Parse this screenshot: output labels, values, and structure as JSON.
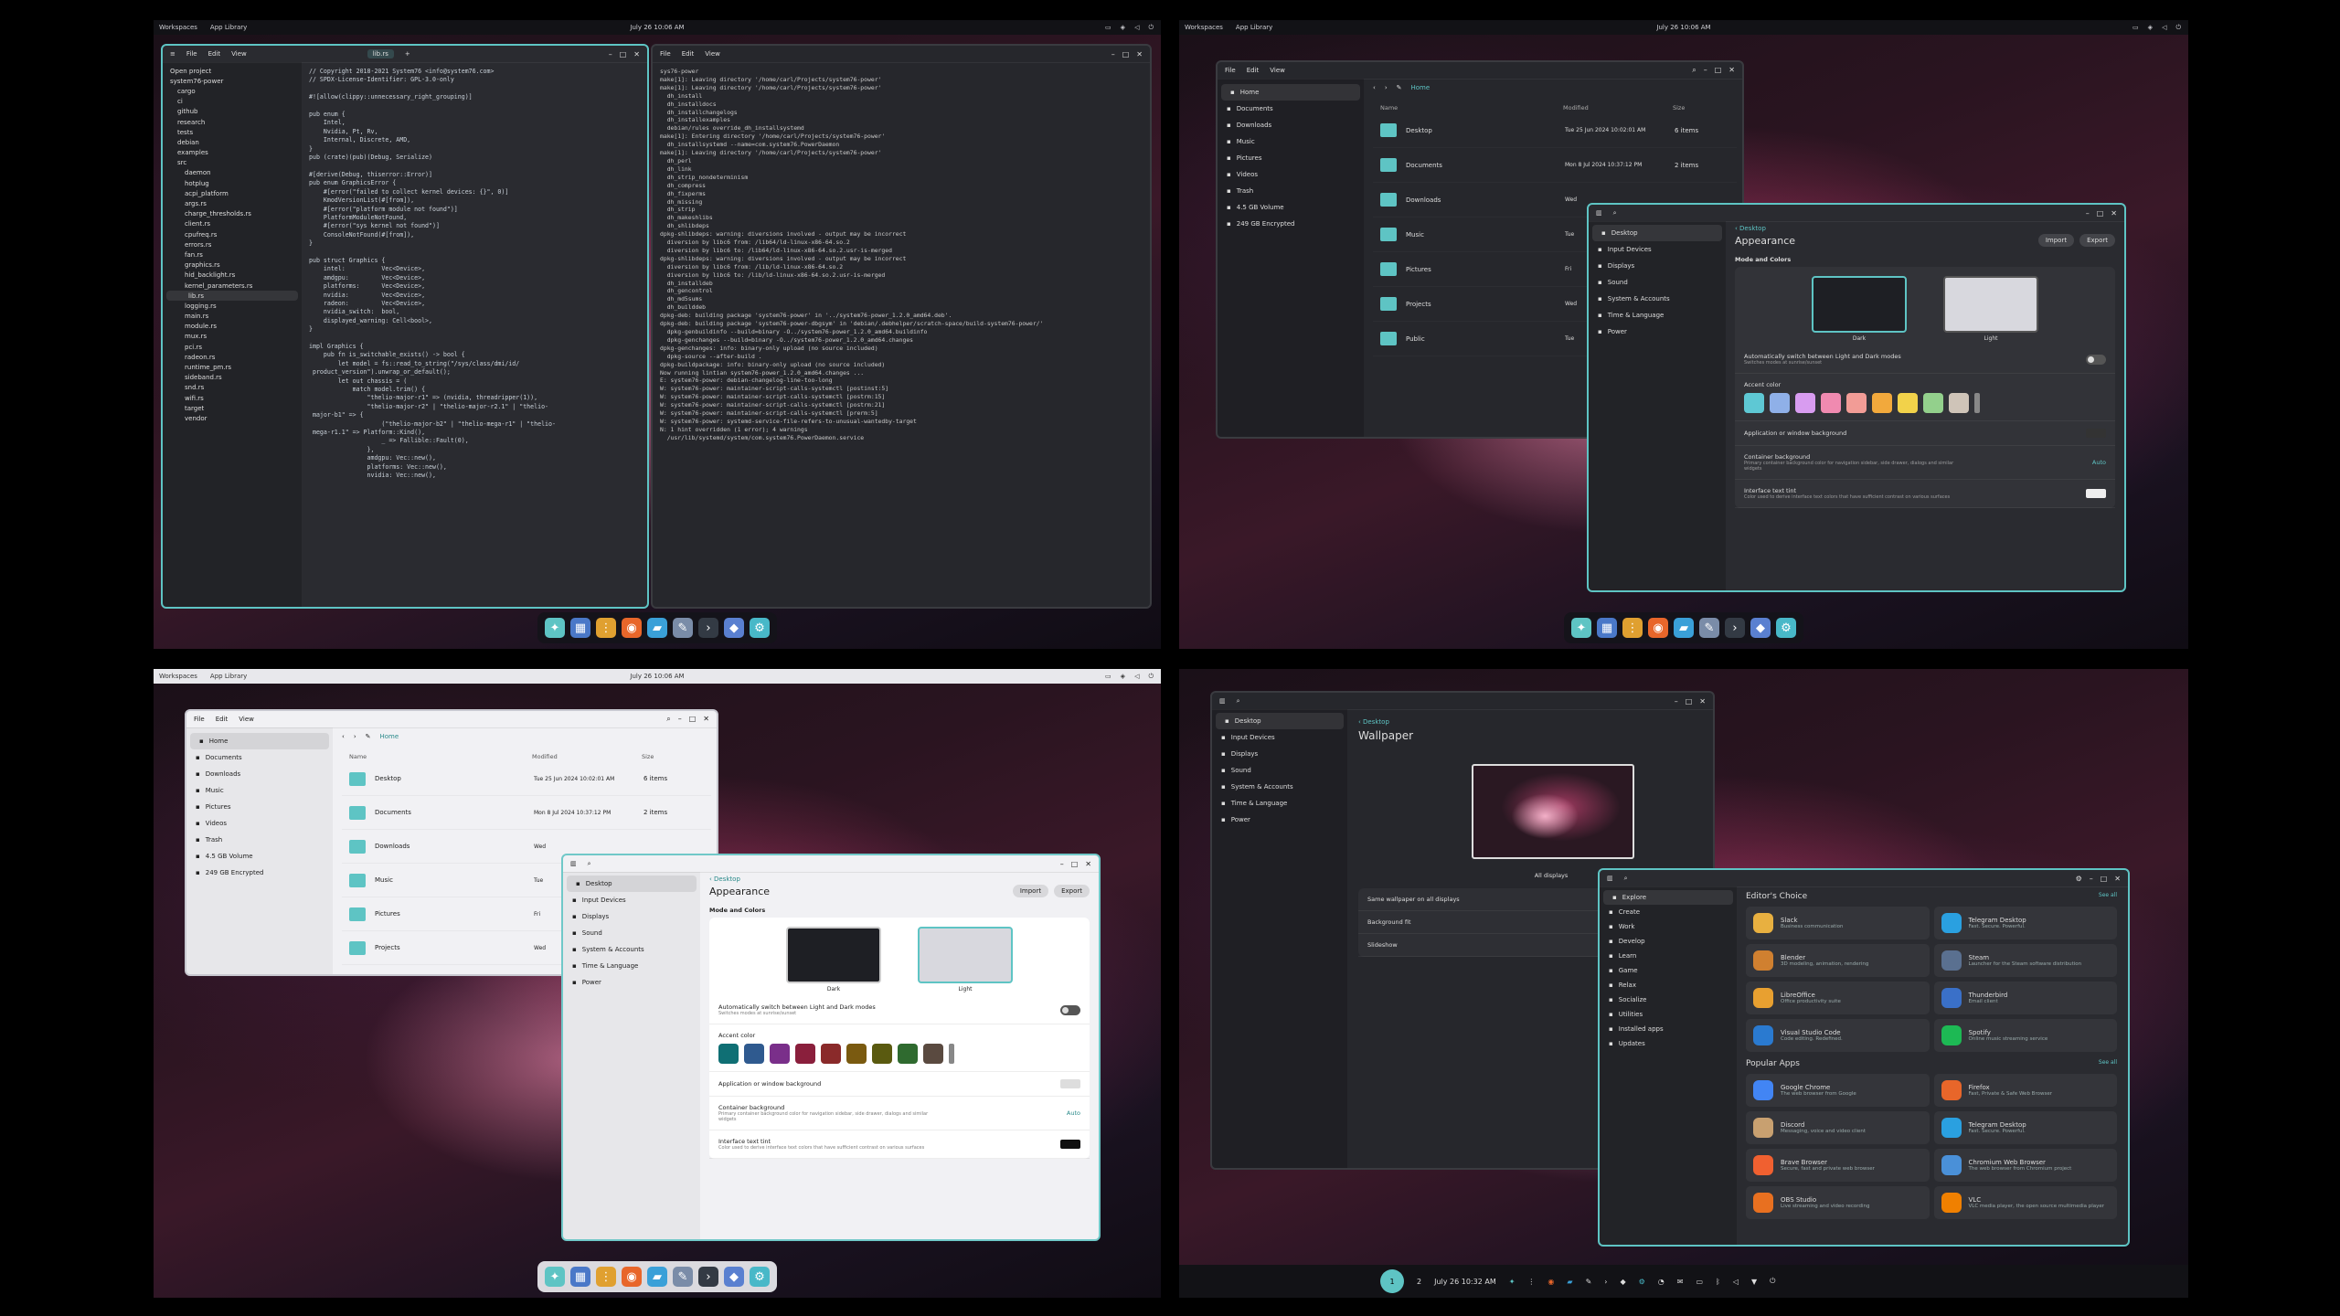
{
  "topbar": {
    "workspaces": "Workspaces",
    "apps": "App Library",
    "clock": "July 26 10:06 AM",
    "clock2": "July 26 10:06 AM",
    "clock3": "July 26 10:06 AM"
  },
  "editor": {
    "menu": [
      "File",
      "Edit",
      "View"
    ],
    "tab": "lib.rs",
    "tree": [
      "Open project",
      "system76-power",
      "cargo",
      "ci",
      "github",
      "research",
      "tests",
      "debian",
      "examples",
      "src",
      "daemon",
      "hotplug",
      "acpi_platform",
      "args.rs",
      "charge_thresholds.rs",
      "client.rs",
      "cpufreq.rs",
      "errors.rs",
      "fan.rs",
      "graphics.rs",
      "hid_backlight.rs",
      "kernel_parameters.rs",
      "lib.rs",
      "logging.rs",
      "main.rs",
      "module.rs",
      "mux.rs",
      "pci.rs",
      "radeon.rs",
      "runtime_pm.rs",
      "sideband.rs",
      "snd.rs",
      "wifi.rs",
      "target",
      "vendor"
    ],
    "code": "// Copyright 2018-2021 System76 <info@system76.com>\n// SPDX-License-Identifier: GPL-3.0-only\n\n#![allow(clippy::unnecessary_right_grouping)]\n\npub enum {\n    Intel,\n    Nvidia, Pt, Rv,\n    Internal, Discrete, AMD,\n}\npub (crate)(pub)(Debug, Serialize)\n\n#[derive(Debug, thiserror::Error)]\npub enum GraphicsError {\n    #[error(\"failed to collect kernel devices: {}\", 0)]\n    KmodVersionList(#[from]),\n    #[error(\"platform module not found\")]\n    PlatformModuleNotFound,\n    #[error(\"sys kernel not found\")]\n    ConsoleNotFound(#[from]),\n}\n\npub struct Graphics {\n    intel:          Vec<Device>,\n    amdgpu:         Vec<Device>,\n    platforms:      Vec<Device>,\n    nvidia:         Vec<Device>,\n    radeon:         Vec<Device>,\n    nvidia_switch:  bool,\n    displayed_warning: Cell<bool>,\n}\n\nimpl Graphics {\n    pub fn is_switchable_exists() -> bool {\n        let model = fs::read_to_string(\"/sys/class/dmi/id/\n product_version\").unwrap_or_default();\n        let out chassis = (\n            match model.trim() {\n                \"thelio-major-r1\" => (nvidia, threadripper(1)),\n                \"thelio-major-r2\" | \"thelio-major-r2.1\" | \"thelio-\n major-b1\" => {\n                    (\"thelio-major-b2\" | \"thelio-mega-r1\" | \"thelio-\n mega-r1.1\" => Platform::Kind(),\n                    _ => Fallible::Fault(0),\n                },\n                amdgpu: Vec::new(),\n                platforms: Vec::new(),\n                nvidia: Vec::new(),",
    "terminal": "sys76-power\nmake[1]: Leaving directory '/home/carl/Projects/system76-power'\nmake[1]: Leaving directory '/home/carl/Projects/system76-power'\n  dh_install\n  dh_installdocs\n  dh_installchangelogs\n  dh_installexamples\n  debian/rules override_dh_installsystemd\nmake[1]: Entering directory '/home/carl/Projects/system76-power'\n  dh_installsystemd --name=com.system76.PowerDaemon\nmake[1]: Leaving directory '/home/carl/Projects/system76-power'\n  dh_perl\n  dh_link\n  dh_strip_nondeterminism\n  dh_compress\n  dh_fixperms\n  dh_missing\n  dh_strip\n  dh_makeshlibs\n  dh_shlibdeps\ndpkg-shlibdeps: warning: diversions involved - output may be incorrect\n  diversion by libc6 from: /lib64/ld-linux-x86-64.so.2\n  diversion by libc6 to: /lib64/ld-linux-x86-64.so.2.usr-is-merged\ndpkg-shlibdeps: warning: diversions involved - output may be incorrect\n  diversion by libc6 from: /lib/ld-linux-x86-64.so.2\n  diversion by libc6 to: /lib/ld-linux-x86-64.so.2.usr-is-merged\n  dh_installdeb\n  dh_gencontrol\n  dh_md5sums\n  dh_builddeb\ndpkg-deb: building package 'system76-power' in '../system76-power_1.2.0_amd64.deb'.\ndpkg-deb: building package 'system76-power-dbgsym' in 'debian/.debhelper/scratch-space/build-system76-power/'\n  dpkg-genbuildinfo --build=binary -O../system76-power_1.2.0_amd64.buildinfo\n  dpkg-genchanges --build=binary -O../system76-power_1.2.0_amd64.changes\ndpkg-genchanges: info: binary-only upload (no source included)\n  dpkg-source --after-build .\ndpkg-buildpackage: info: binary-only upload (no source included)\nNow running lintian system76-power_1.2.0_amd64.changes ...\nE: system76-power: debian-changelog-line-too-long\nW: system76-power: maintainer-script-calls-systemctl [postinst:5]\nW: system76-power: maintainer-script-calls-systemctl [postrm:15]\nW: system76-power: maintainer-script-calls-systemctl [postrm:21]\nW: system76-power: maintainer-script-calls-systemctl [prerm:5]\nW: system76-power: systemd-service-file-refers-to-unusual-wantedby-target\nN: 1 hint overridden (1 error); 4 warnings\n  /usr/lib/systemd/system/com.system76.PowerDaemon.service"
  },
  "files": {
    "menu": [
      "File",
      "Edit",
      "View"
    ],
    "crumb": "Home",
    "sidebar": [
      "Home",
      "Documents",
      "Downloads",
      "Music",
      "Pictures",
      "Videos",
      "Trash",
      "4.5 GB Volume",
      "249 GB Encrypted"
    ],
    "cols": [
      "Name",
      "Modified",
      "Size"
    ],
    "rows": [
      {
        "name": "Desktop",
        "mod": "Tue 25 Jun 2024 10:02:01 AM",
        "size": "6 items"
      },
      {
        "name": "Documents",
        "mod": "Mon 8 Jul 2024 10:37:12 PM",
        "size": "2 items"
      },
      {
        "name": "Downloads",
        "mod": "Wed",
        "size": ""
      },
      {
        "name": "Music",
        "mod": "Tue",
        "size": ""
      },
      {
        "name": "Pictures",
        "mod": "Fri",
        "size": ""
      },
      {
        "name": "Projects",
        "mod": "Wed",
        "size": ""
      },
      {
        "name": "Public",
        "mod": "Tue",
        "size": ""
      }
    ]
  },
  "settings": {
    "nav": [
      "Desktop",
      "Input Devices",
      "Displays",
      "Sound",
      "System & Accounts",
      "Time & Language",
      "Power"
    ],
    "back": "Desktop",
    "title": "Appearance",
    "import": "Import",
    "export": "Export",
    "section": "Mode and Colors",
    "dark": "Dark",
    "light": "Light",
    "auto_label": "Automatically switch between Light and Dark modes",
    "auto_sub": "Switches modes at sunrise/sunset",
    "accent_label": "Accent color",
    "app_bg": "Application or window background",
    "container_bg": "Container background",
    "container_sub": "Primary container background color for navigation sidebar, side drawer, dialogs and similar widgets",
    "auto": "Auto",
    "text_tint": "Interface text tint",
    "text_sub": "Color used to derive interface text colors that have sufficient contrast on various surfaces",
    "accent_dark": [
      "#5ec8d4",
      "#8fb0e8",
      "#d89cf0",
      "#f08ab0",
      "#f29c96",
      "#f2a93c",
      "#f2d24a",
      "#93d08c",
      "#cfc4b8"
    ],
    "accent_light": [
      "#0f6f74",
      "#2f5a8f",
      "#7a2f8a",
      "#8a1f3c",
      "#8a2a2a",
      "#7a5a10",
      "#5a5a10",
      "#2f6a2f",
      "#5a4a40"
    ]
  },
  "wallpaper": {
    "nav": [
      "Desktop",
      "Input Devices",
      "Displays",
      "Sound",
      "System & Accounts",
      "Time & Language",
      "Power"
    ],
    "back": "Desktop",
    "title": "Wallpaper",
    "all": "All displays",
    "same": "Same wallpaper on all displays",
    "fit": "Background fit",
    "slideshow": "Slideshow"
  },
  "store": {
    "nav": [
      "Explore",
      "Create",
      "Work",
      "Develop",
      "Learn",
      "Game",
      "Relax",
      "Socialize",
      "Utilities",
      "Installed apps",
      "Updates"
    ],
    "editors": "Editor's Choice",
    "popular": "Popular Apps",
    "see_all": "See all",
    "editor_apps": [
      {
        "name": "Slack",
        "desc": "Business communication"
      },
      {
        "name": "Telegram Desktop",
        "desc": "Fast. Secure. Powerful."
      },
      {
        "name": "Blender",
        "desc": "3D modeling, animation, rendering"
      },
      {
        "name": "Steam",
        "desc": "Launcher for the Steam software distribution"
      },
      {
        "name": "LibreOffice",
        "desc": "Office productivity suite"
      },
      {
        "name": "Thunderbird",
        "desc": "Email client"
      },
      {
        "name": "Visual Studio Code",
        "desc": "Code editing. Redefined."
      },
      {
        "name": "Spotify",
        "desc": "Online music streaming service"
      }
    ],
    "popular_apps": [
      {
        "name": "Google Chrome",
        "desc": "The web browser from Google"
      },
      {
        "name": "Firefox",
        "desc": "Fast, Private & Safe Web Browser"
      },
      {
        "name": "Discord",
        "desc": "Messaging, voice and video client"
      },
      {
        "name": "Telegram Desktop",
        "desc": "Fast. Secure. Powerful."
      },
      {
        "name": "Brave Browser",
        "desc": "Secure, fast and private web browser"
      },
      {
        "name": "Chromium Web Browser",
        "desc": "The web browser from Chromium project"
      },
      {
        "name": "OBS Studio",
        "desc": "Live streaming and video recording"
      },
      {
        "name": "VLC",
        "desc": "VLC media player, the open source multimedia player"
      }
    ]
  },
  "panel": {
    "ws1": "1",
    "ws2": "2",
    "clock": "July 26 10:32 AM"
  },
  "icons": [
    "launcher-icon",
    "workspaces-icon",
    "app-grid-icon",
    "firefox-icon",
    "files-icon",
    "text-editor-icon",
    "terminal-icon",
    "store-icon",
    "settings-icon"
  ]
}
